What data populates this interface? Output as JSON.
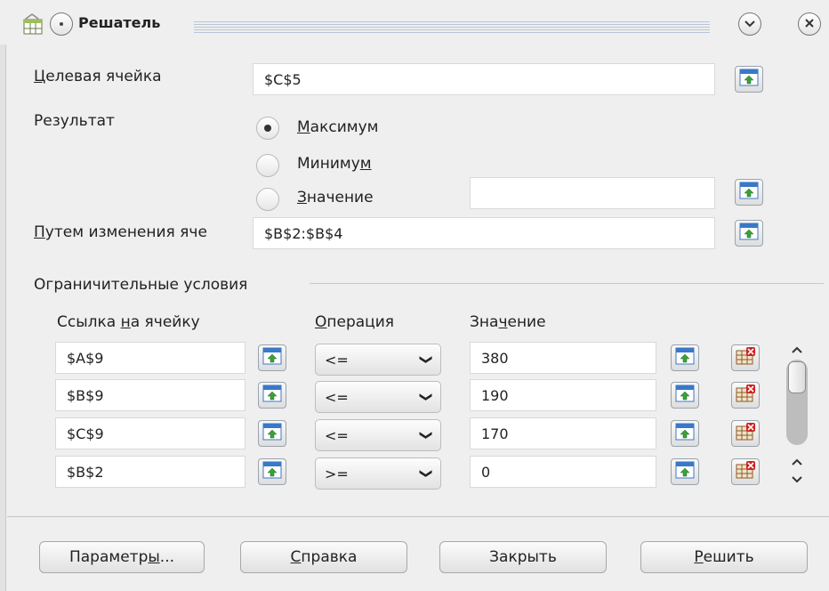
{
  "window": {
    "title": "Решатель"
  },
  "target_cell": {
    "label_pre": "",
    "label_mn": "Ц",
    "label_post": "елевая ячейка",
    "value": "$C$5"
  },
  "result": {
    "label": "Результат",
    "options": [
      {
        "pre": "",
        "mn": "М",
        "post": "аксимум",
        "checked": true
      },
      {
        "pre": "Миниму",
        "mn": "м",
        "post": "",
        "checked": false
      },
      {
        "pre": "",
        "mn": "З",
        "post": "начение",
        "checked": false
      }
    ],
    "value_field": ""
  },
  "changing_cells": {
    "label_pre": "",
    "label_mn": "П",
    "label_post": "утем изменения яче",
    "value": "$B$2:$B$4"
  },
  "constraints": {
    "group_label": "Ограничительные условия",
    "col_ref": {
      "pre": "Ссылка ",
      "mn": "н",
      "post": "а ячейку"
    },
    "col_op": {
      "pre": "",
      "mn": "О",
      "post": "перация"
    },
    "col_val": {
      "pre": "Зна",
      "mn": "ч",
      "post": "ение"
    },
    "rows": [
      {
        "ref": "$A$9",
        "op": "<=",
        "value": "380"
      },
      {
        "ref": "$B$9",
        "op": "<=",
        "value": "190"
      },
      {
        "ref": "$C$9",
        "op": "<=",
        "value": "170"
      },
      {
        "ref": "$B$2",
        "op": ">=",
        "value": "0"
      }
    ]
  },
  "buttons": {
    "options": {
      "pre": "Параметр",
      "mn": "ы",
      "post": "..."
    },
    "help": {
      "pre": "",
      "mn": "С",
      "post": "правка"
    },
    "close": {
      "pre": "Закрыть",
      "mn": "",
      "post": ""
    },
    "solve": {
      "pre": "",
      "mn": "Р",
      "post": "ешить"
    }
  },
  "colors": {
    "window_bg": "#efefef",
    "field_bg": "#ffffff",
    "icon_blue": "#3a78c8",
    "icon_green": "#3aa03a",
    "icon_red": "#d02020"
  }
}
